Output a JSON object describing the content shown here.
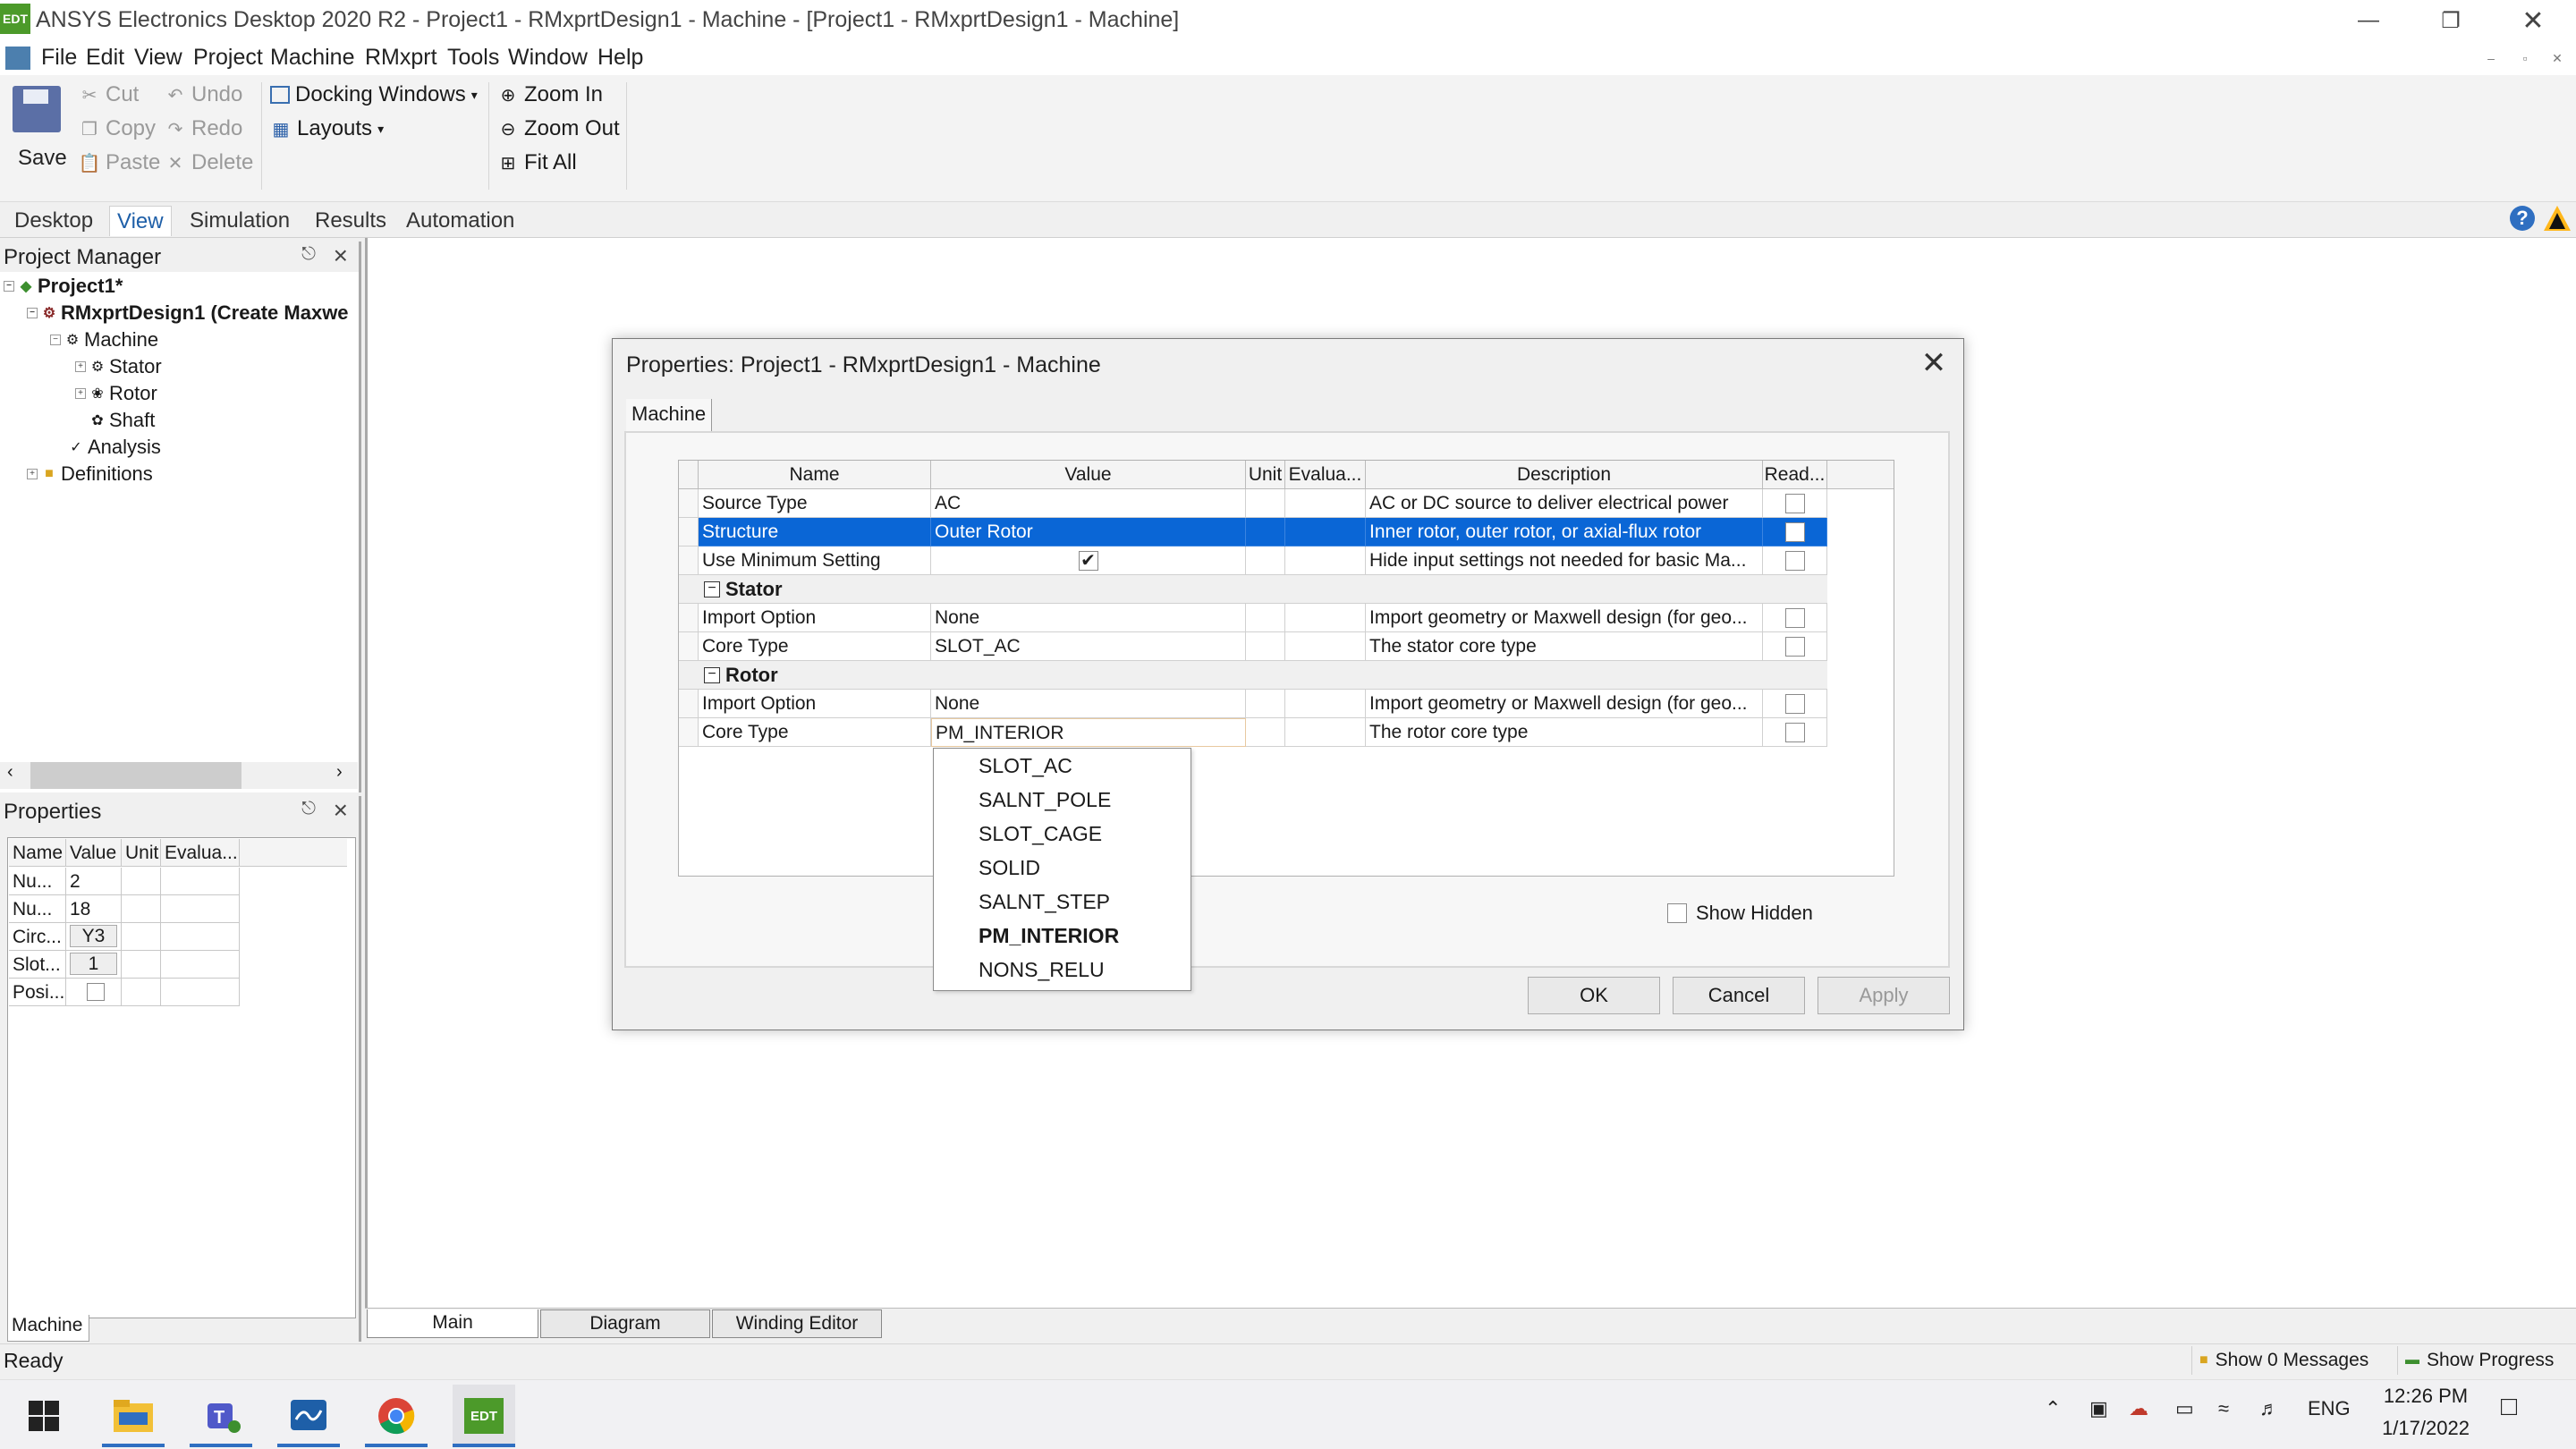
{
  "window": {
    "title": "ANSYS Electronics Desktop 2020 R2 - Project1 - RMxprtDesign1 - Machine - [Project1 - RMxprtDesign1 - Machine]",
    "app_icon_text": "EDT"
  },
  "menu": {
    "items": [
      "File",
      "Edit",
      "View",
      "Project",
      "Machine",
      "RMxprt",
      "Tools",
      "Window",
      "Help"
    ]
  },
  "ribbon": {
    "save": "Save",
    "cut": "Cut",
    "copy": "Copy",
    "paste": "Paste",
    "undo": "Undo",
    "redo": "Redo",
    "delete": "Delete",
    "docking_windows": "Docking Windows",
    "layouts": "Layouts",
    "zoom_in": "Zoom In",
    "zoom_out": "Zoom Out",
    "fit_all": "Fit All",
    "tabs": [
      "Desktop",
      "View",
      "Simulation",
      "Results",
      "Automation"
    ],
    "active_tab": "View"
  },
  "project_manager": {
    "title": "Project Manager",
    "tree": {
      "project": "Project1*",
      "design": "RMxprtDesign1 (Create Maxwe",
      "machine": "Machine",
      "stator": "Stator",
      "rotor": "Rotor",
      "shaft": "Shaft",
      "analysis": "Analysis",
      "definitions": "Definitions"
    }
  },
  "properties_panel": {
    "title": "Properties",
    "headers": [
      "Name",
      "Value",
      "Unit",
      "Evalua..."
    ],
    "rows": [
      {
        "name": "Nu...",
        "value": "2"
      },
      {
        "name": "Nu...",
        "value": "18"
      },
      {
        "name": "Circ...",
        "value": "Y3"
      },
      {
        "name": "Slot...",
        "value": "1"
      },
      {
        "name": "Posi...",
        "value": ""
      }
    ],
    "tab": "Machine"
  },
  "workspace_tabs": [
    "Main",
    "Diagram",
    "Winding Editor"
  ],
  "dialog": {
    "title": "Properties: Project1 - RMxprtDesign1 - Machine",
    "tab": "Machine",
    "headers": [
      "Name",
      "Value",
      "Unit",
      "Evalua...",
      "Description",
      "Read..."
    ],
    "rows": [
      {
        "name": "Source Type",
        "value": "AC",
        "description": "AC or DC source to deliver electrical power"
      },
      {
        "name": "Structure",
        "value": "Outer Rotor",
        "description": "Inner rotor, outer rotor, or axial-flux rotor"
      },
      {
        "name": "Use Minimum Setting",
        "value": "",
        "description": "Hide input settings not needed for basic Ma..."
      },
      {
        "name": "Import Option",
        "value": "None",
        "description": "Import geometry or Maxwell design (for geo..."
      },
      {
        "name": "Core Type",
        "value": "SLOT_AC",
        "description": "The stator core type"
      },
      {
        "name": "Import Option",
        "value": "None",
        "description": "Import geometry or Maxwell design (for geo..."
      },
      {
        "name": "Core Type",
        "value": "PM_INTERIOR",
        "description": "The rotor core type"
      }
    ],
    "groups": {
      "stator": "Stator",
      "rotor": "Rotor"
    },
    "dropdown_options": [
      "SLOT_AC",
      "SALNT_POLE",
      "SLOT_CAGE",
      "SOLID",
      "SALNT_STEP",
      "PM_INTERIOR",
      "NONS_RELU"
    ],
    "dropdown_selected": "PM_INTERIOR",
    "show_hidden": "Show Hidden",
    "ok": "OK",
    "cancel": "Cancel",
    "apply": "Apply"
  },
  "status": {
    "text": "Ready",
    "messages": "Show 0 Messages",
    "progress": "Show Progress"
  },
  "taskbar": {
    "edt_label": "EDT",
    "lang": "ENG",
    "time": "12:26 PM",
    "date": "1/17/2022"
  },
  "colors": {
    "selection": "#0a66d6",
    "accent": "#2f6fc1"
  }
}
